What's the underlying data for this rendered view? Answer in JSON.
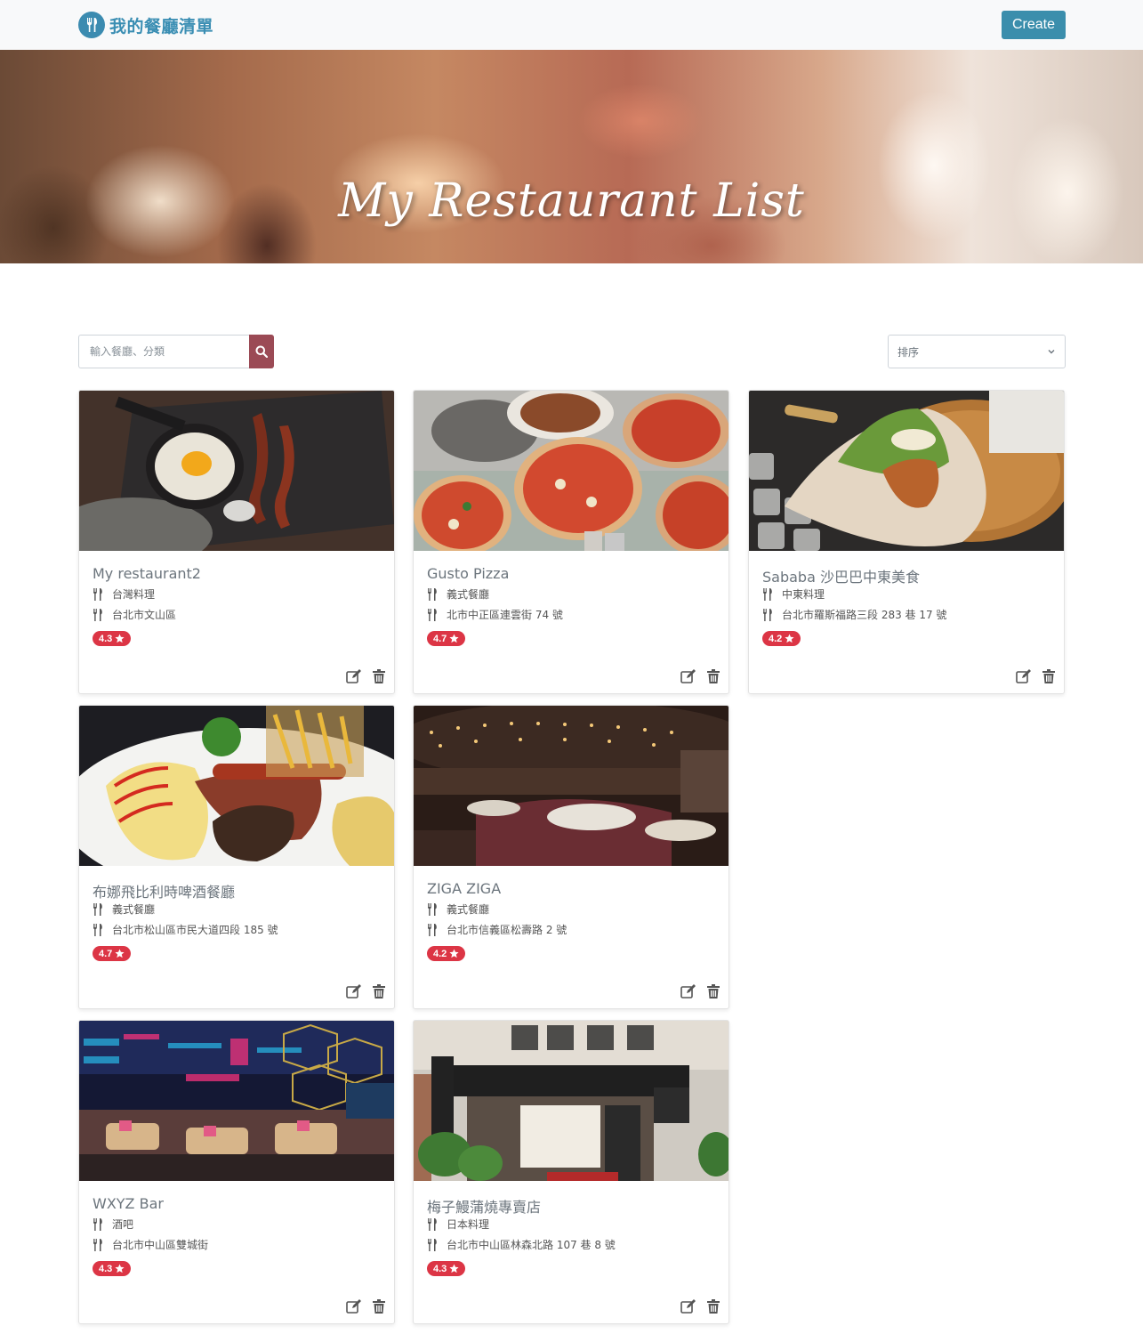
{
  "navbar": {
    "brand": "我的餐廳清單",
    "create_label": "Create"
  },
  "banner": {
    "title": "My Restaurant List"
  },
  "search": {
    "placeholder": "輸入餐廳、分類"
  },
  "sort": {
    "selected": "排序"
  },
  "restaurants": [
    {
      "name": "My restaurant2",
      "category": "台灣料理",
      "location": "台北市文山區",
      "rating": "4.3"
    },
    {
      "name": "Gusto Pizza",
      "category": "義式餐廳",
      "location": "北市中正區連雲街 74 號",
      "rating": "4.7"
    },
    {
      "name": "Sababa 沙巴巴中東美食",
      "category": "中東料理",
      "location": "台北市羅斯福路三段 283 巷 17 號",
      "rating": "4.2"
    },
    {
      "name": "布娜飛比利時啤酒餐廳",
      "category": "義式餐廳",
      "location": "台北市松山區市民大道四段 185 號",
      "rating": "4.7"
    },
    {
      "name": "ZIGA ZIGA",
      "category": "義式餐廳",
      "location": "台北市信義區松壽路 2 號",
      "rating": "4.2"
    },
    {
      "name": "WXYZ Bar",
      "category": "酒吧",
      "location": "台北市中山區雙城街",
      "rating": "4.3"
    },
    {
      "name": "梅子鰻蒲燒專賣店",
      "category": "日本料理",
      "location": "台北市中山區林森北路 107 巷 8 號",
      "rating": "4.3"
    }
  ],
  "icons": {
    "category": "utensils-icon",
    "location": "utensils-icon",
    "rating": "star-icon",
    "edit": "edit-icon",
    "delete": "trash-icon",
    "search": "search-icon"
  },
  "colors": {
    "brand": "#3a8eb3",
    "create_button": "#3b8eac",
    "search_button": "#9b4a55",
    "rating_badge": "#dc3545"
  }
}
